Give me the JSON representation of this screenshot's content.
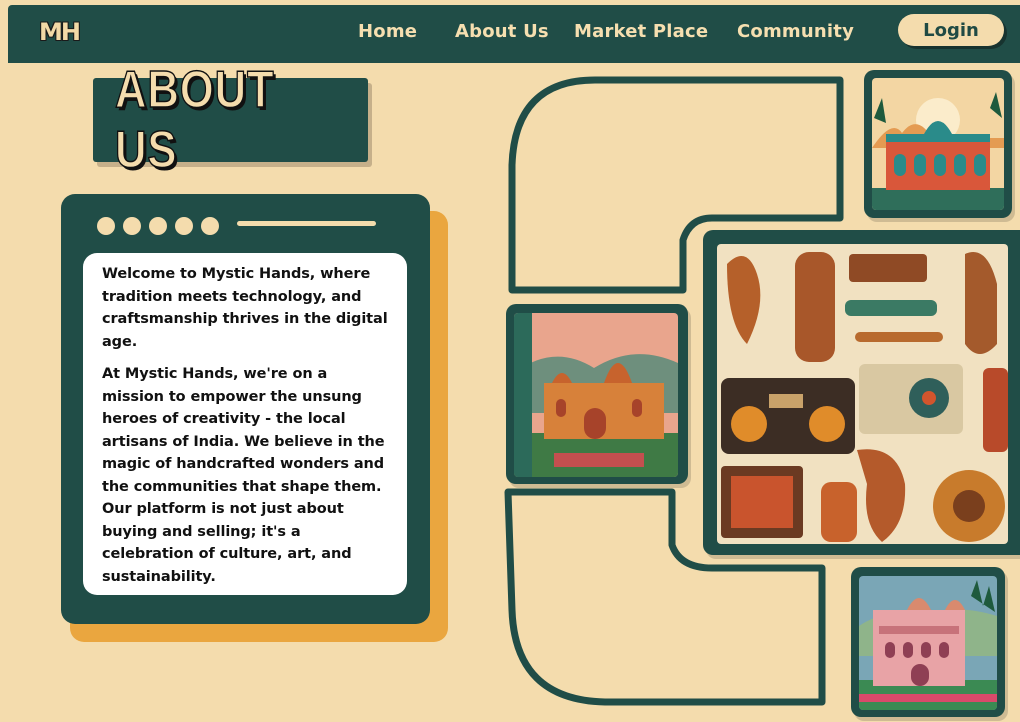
{
  "nav": {
    "logo": "MH",
    "links": [
      {
        "label": "Home"
      },
      {
        "label": "About Us"
      },
      {
        "label": "Market Place"
      },
      {
        "label": "Community"
      }
    ],
    "login_label": "Login"
  },
  "about": {
    "title": "ABOUT US",
    "paragraphs": [
      "Welcome to Mystic Hands, where tradition meets technology, and craftsmanship thrives in the digital age.",
      "At Mystic Hands, we're on a mission to empower the unsung heroes of creativity - the local artisans of India. We believe in the magic of handcrafted wonders and the communities that shape them. Our platform is not just about buying and selling; it's a celebration of culture, art, and sustainability."
    ]
  },
  "colors": {
    "background": "#f4dcad",
    "primary": "#204d47",
    "accent": "#eaa63f"
  }
}
